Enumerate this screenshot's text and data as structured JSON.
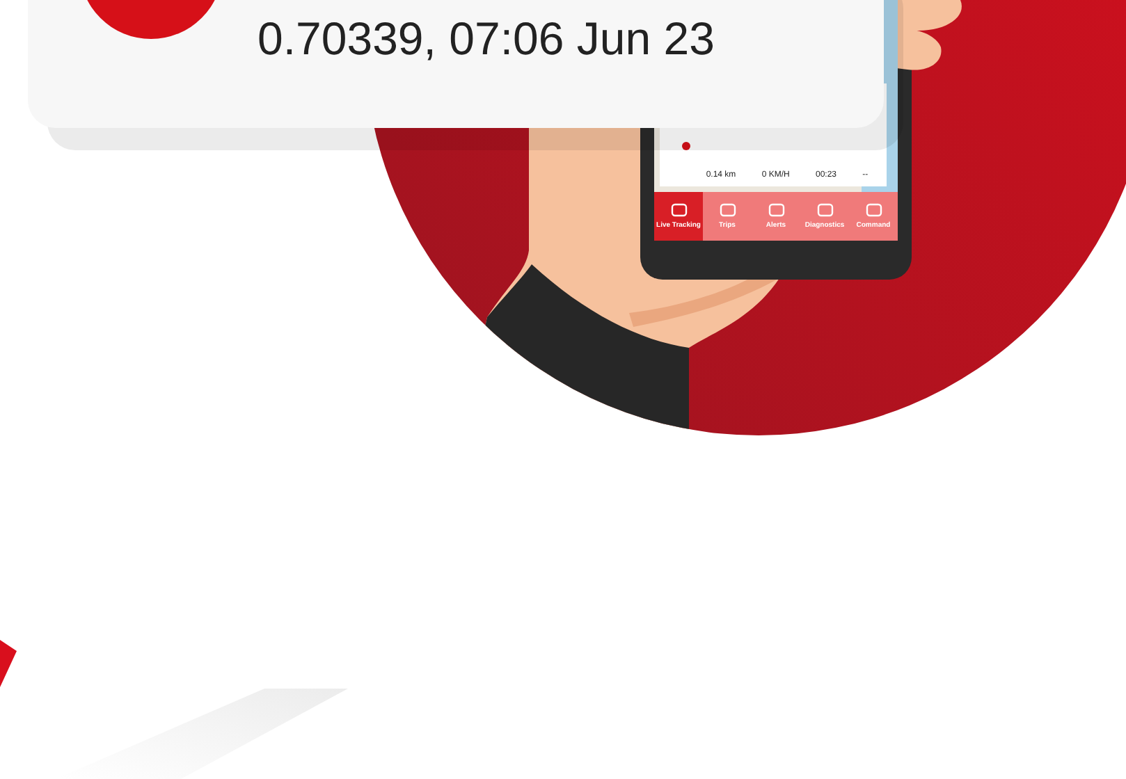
{
  "notification": {
    "text": "0.70339, 07:06 Jun 23"
  },
  "phone": {
    "stats": [
      "0.14 km",
      "0 KM/H",
      "00:23",
      "--"
    ],
    "tabs": [
      {
        "label": "Live Tracking",
        "selected": true
      },
      {
        "label": "Trips",
        "selected": false
      },
      {
        "label": "Alerts",
        "selected": false
      },
      {
        "label": "Diagnostics",
        "selected": false
      },
      {
        "label": "Command",
        "selected": false
      }
    ]
  }
}
